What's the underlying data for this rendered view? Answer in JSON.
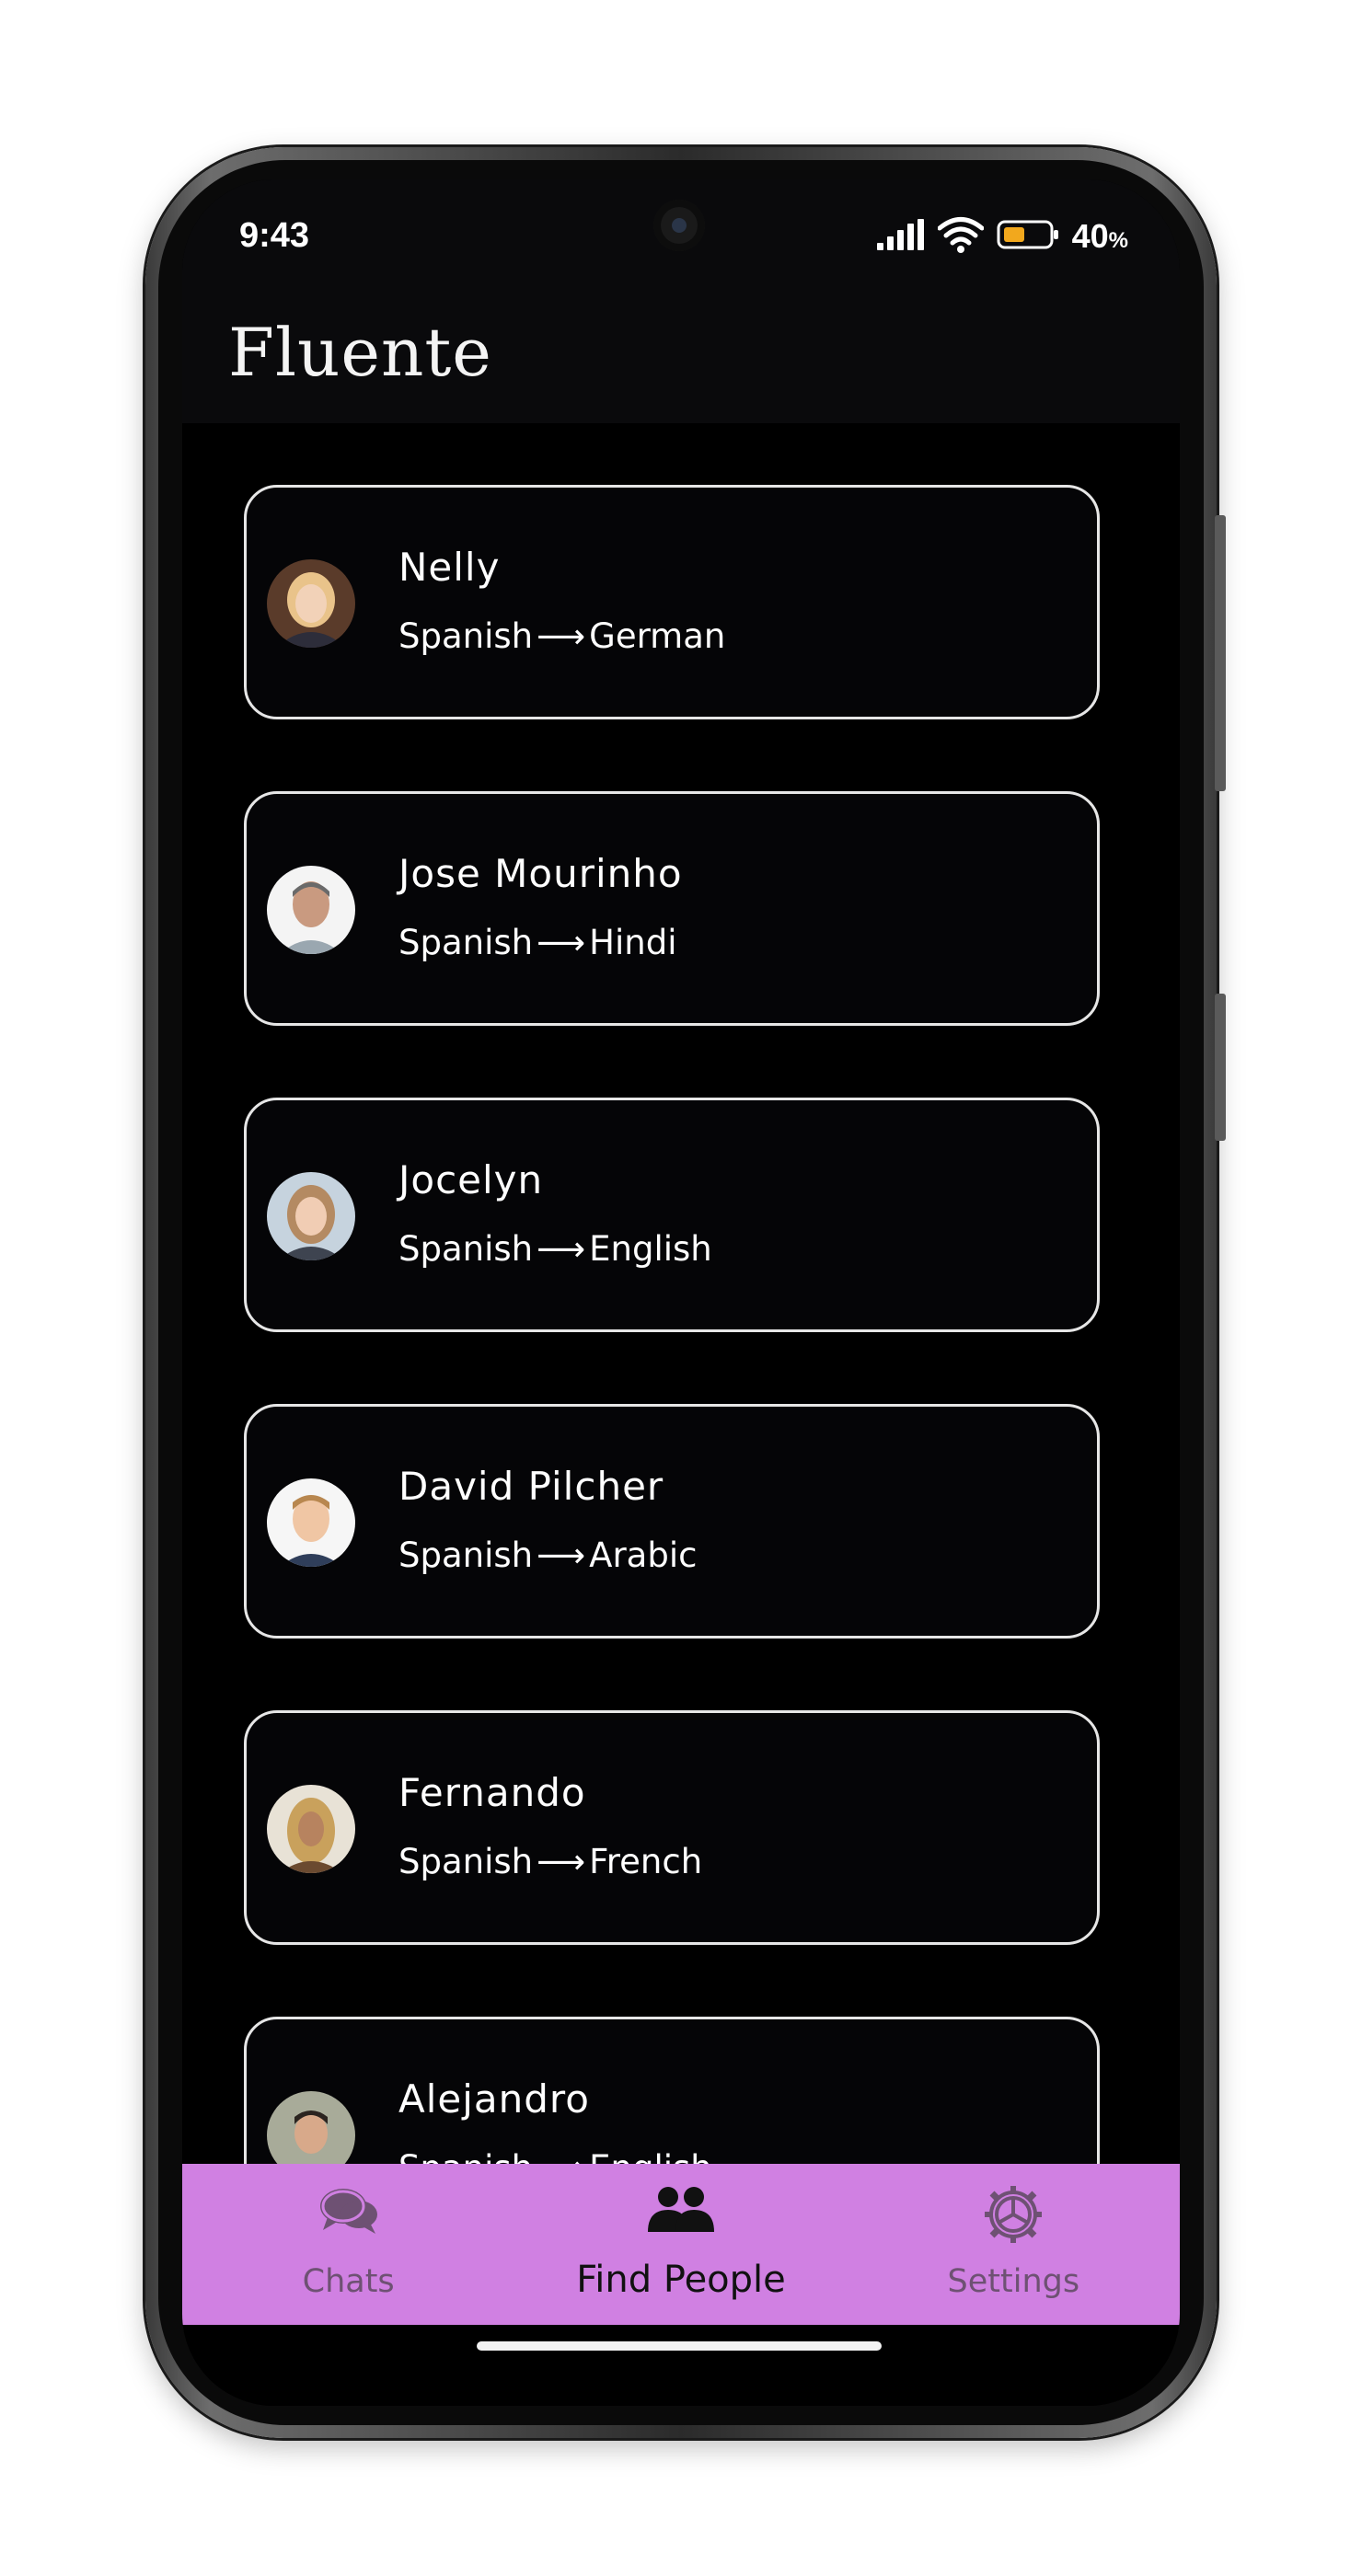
{
  "status_bar": {
    "time": "9:43",
    "battery_percent": "40",
    "battery_unit": "%"
  },
  "app_bar": {
    "title": "Fluente"
  },
  "people": [
    {
      "name": "Nelly",
      "from": "Spanish",
      "to": "German",
      "avatar_color": "#b27a4e"
    },
    {
      "name": "Jose Mourinho",
      "from": "Spanish",
      "to": "Hindi",
      "avatar_color": "#8a8a8a"
    },
    {
      "name": "Jocelyn",
      "from": "Spanish",
      "to": "English",
      "avatar_color": "#c9a27c"
    },
    {
      "name": "David Pilcher",
      "from": "Spanish",
      "to": "Arabic",
      "avatar_color": "#d9b08c"
    },
    {
      "name": "Fernando",
      "from": "Spanish",
      "to": "French",
      "avatar_color": "#a07a52"
    },
    {
      "name": "Alejandro",
      "from": "Spanish",
      "to": "English",
      "avatar_color": "#6d6d62"
    }
  ],
  "arrow_glyph": "⟶",
  "bottom_nav": {
    "items": [
      {
        "label": "Chats",
        "icon": "chat-bubbles-icon",
        "active": false
      },
      {
        "label": "Find People",
        "icon": "people-icon",
        "active": true
      },
      {
        "label": "Settings",
        "icon": "gear-icon",
        "active": false
      }
    ]
  },
  "colors": {
    "background": "#000000",
    "nav_background": "#d080e2",
    "nav_inactive": "#6e5173",
    "card_border": "#e6e6e6"
  }
}
